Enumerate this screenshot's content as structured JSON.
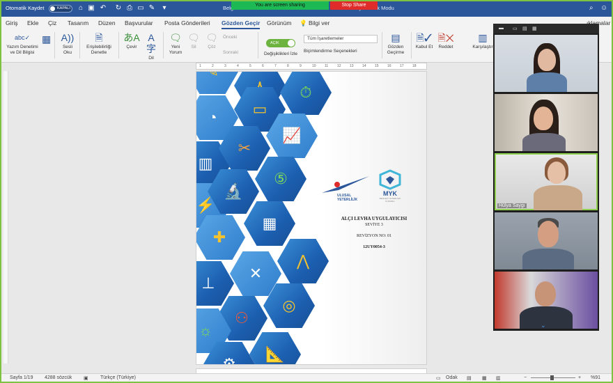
{
  "titlebar": {
    "autosave_label": "Otomatik Kaydet",
    "autosave_state": "KAPALI",
    "doc_title": "Belge1",
    "mode": "Uyumluluk Modu",
    "share_banner": "You are screen sharing",
    "stop_share": "Stop Share"
  },
  "tabs": [
    "Giriş",
    "Ekle",
    "Çiz",
    "Tasarım",
    "Düzen",
    "Başvurular",
    "Posta Gönderileri",
    "Gözden Geçir",
    "Görünüm",
    "Bilgi ver"
  ],
  "active_tab": "Gözden Geçir",
  "comments_label": "ıklamalar",
  "ribbon": {
    "spelling": "Yazım Denetimi ve Dil Bilgisi",
    "read_aloud": "Sesli Oku",
    "accessibility": "Erişilebilirliği Denetle",
    "translate": "Çevir",
    "language": "Dil",
    "new_comment": "Yeni Yorum",
    "delete": "Sil",
    "resolve": "Çöz",
    "previous": "Önceki",
    "next": "Sonraki",
    "track_toggle": "AÇIK",
    "track_changes": "Değişiklikleri İzle",
    "markup_select": "Tüm İşaretlemeler",
    "format_options": "Biçimlendirme Seçenekleri",
    "review_pane": "Gözden Geçirme",
    "accept": "Kabul Et",
    "reject": "Reddet",
    "compare": "Karşılaştır"
  },
  "ruler_ticks": [
    "1",
    "2",
    "3",
    "4",
    "5",
    "6",
    "7",
    "8",
    "9",
    "10",
    "11",
    "12",
    "13",
    "14",
    "15",
    "16",
    "17",
    "18"
  ],
  "document": {
    "logo_left": "ULUSAL YETERLİLİK",
    "logo_right": "MYK",
    "logo_right_sub": "MESLEKİ YETERLİLİK KURUMU",
    "title": "ALÇI LEVHA UYGULAYICISI",
    "level": "SEVİYE 3",
    "revision": "REVİZYON NO: 01",
    "code": "12UY0054-3"
  },
  "statusbar": {
    "page": "Sayfa 1/19",
    "words": "4288 sözcük",
    "language": "Türkçe (Türkiye)",
    "focus": "Odak",
    "zoom": "%91"
  },
  "gallery": {
    "participants": [
      {
        "name": ""
      },
      {
        "name": ""
      },
      {
        "name": "Hülya Saygı"
      },
      {
        "name": ""
      },
      {
        "name": ""
      }
    ]
  },
  "colors": {
    "word_blue": "#2b579a",
    "share_green": "#1db954",
    "stop_red": "#e02b2b",
    "speaker_outline": "#8fd14f",
    "hex_blue": "#1c5fb0"
  }
}
